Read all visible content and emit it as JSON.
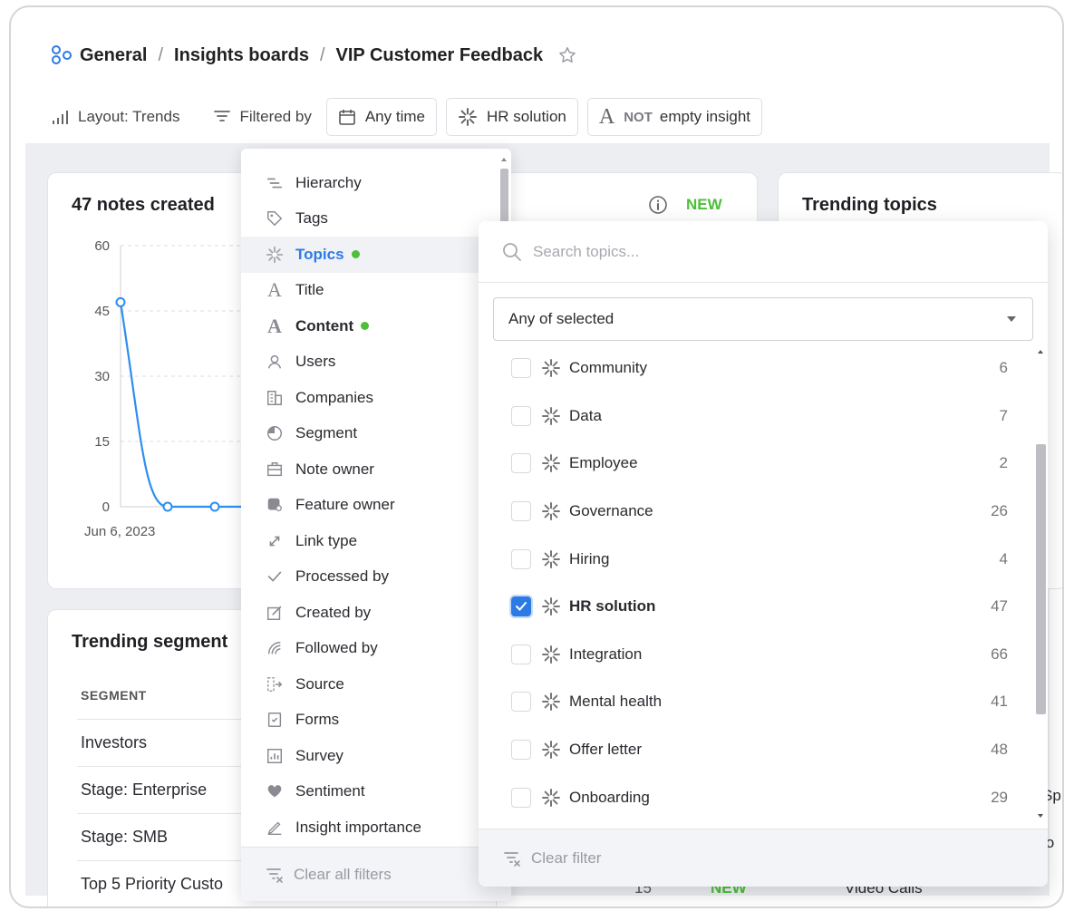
{
  "breadcrumb": {
    "items": [
      "General",
      "Insights boards",
      "VIP Customer Feedback"
    ],
    "separator": "/"
  },
  "toolbar": {
    "layout_label": "Layout: Trends",
    "filtered_by_label": "Filtered by",
    "chips": {
      "time": "Any time",
      "topic": "HR solution",
      "not_label": "NOT",
      "content": "empty insight"
    }
  },
  "cards": {
    "notes": {
      "title": "47 notes created",
      "y_ticks": [
        "60",
        "45",
        "30",
        "15",
        "0"
      ],
      "x_start": "Jun 6, 2023"
    },
    "middle": {
      "new_badge": "NEW"
    },
    "trending_topics": {
      "title": "Trending topics",
      "partial_row1": "Sp",
      "partial_row2": "lo",
      "bottom_item": "Video Calls"
    },
    "trending_segments": {
      "title": "Trending segment",
      "column_header": "SEGMENT",
      "rows": [
        "Investors",
        "Stage: Enterprise",
        "Stage: SMB",
        "Top 5 Priority Custo"
      ],
      "bottom_value": "15",
      "bottom_badge": "NEW"
    }
  },
  "chart_data": {
    "type": "line",
    "x": [
      "Jun 6, 2023",
      "",
      ""
    ],
    "values": [
      47,
      0,
      0
    ],
    "ylim": [
      0,
      60
    ],
    "yticks": [
      0,
      15,
      30,
      45,
      60
    ],
    "color": "#2c8ef0",
    "grid": true
  },
  "filter_menu": {
    "items": [
      {
        "label": "Hierarchy",
        "icon": "hierarchy-icon"
      },
      {
        "label": "Tags",
        "icon": "tag-icon"
      },
      {
        "label": "Topics",
        "icon": "topic-icon",
        "active": true,
        "dot": true
      },
      {
        "label": "Title",
        "icon": "title-icon"
      },
      {
        "label": "Content",
        "icon": "content-icon",
        "bold": true,
        "dot": true
      },
      {
        "label": "Users",
        "icon": "user-icon"
      },
      {
        "label": "Companies",
        "icon": "building-icon"
      },
      {
        "label": "Segment",
        "icon": "pie-icon"
      },
      {
        "label": "Note owner",
        "icon": "briefcase-icon"
      },
      {
        "label": "Feature owner",
        "icon": "feature-owner-icon"
      },
      {
        "label": "Link type",
        "icon": "link-icon"
      },
      {
        "label": "Processed by",
        "icon": "check-icon"
      },
      {
        "label": "Created by",
        "icon": "edit-icon"
      },
      {
        "label": "Followed by",
        "icon": "follow-icon"
      },
      {
        "label": "Source",
        "icon": "source-icon"
      },
      {
        "label": "Forms",
        "icon": "form-icon"
      },
      {
        "label": "Survey",
        "icon": "survey-icon"
      },
      {
        "label": "Sentiment",
        "icon": "heart-icon"
      },
      {
        "label": "Insight importance",
        "icon": "importance-icon"
      }
    ],
    "footer": "Clear all filters"
  },
  "topics_panel": {
    "search_placeholder": "Search topics...",
    "match_mode": "Any of selected",
    "options": [
      {
        "name": "Community",
        "count": "6",
        "checked": false
      },
      {
        "name": "Data",
        "count": "7",
        "checked": false
      },
      {
        "name": "Employee",
        "count": "2",
        "checked": false
      },
      {
        "name": "Governance",
        "count": "26",
        "checked": false
      },
      {
        "name": "Hiring",
        "count": "4",
        "checked": false
      },
      {
        "name": "HR solution",
        "count": "47",
        "checked": true
      },
      {
        "name": "Integration",
        "count": "66",
        "checked": false
      },
      {
        "name": "Mental health",
        "count": "41",
        "checked": false
      },
      {
        "name": "Offer letter",
        "count": "48",
        "checked": false
      },
      {
        "name": "Onboarding",
        "count": "29",
        "checked": false
      }
    ],
    "footer": "Clear filter"
  },
  "colors": {
    "accent": "#2c7be5",
    "dot_green": "#4cc038",
    "new_green": "#4cc038"
  }
}
